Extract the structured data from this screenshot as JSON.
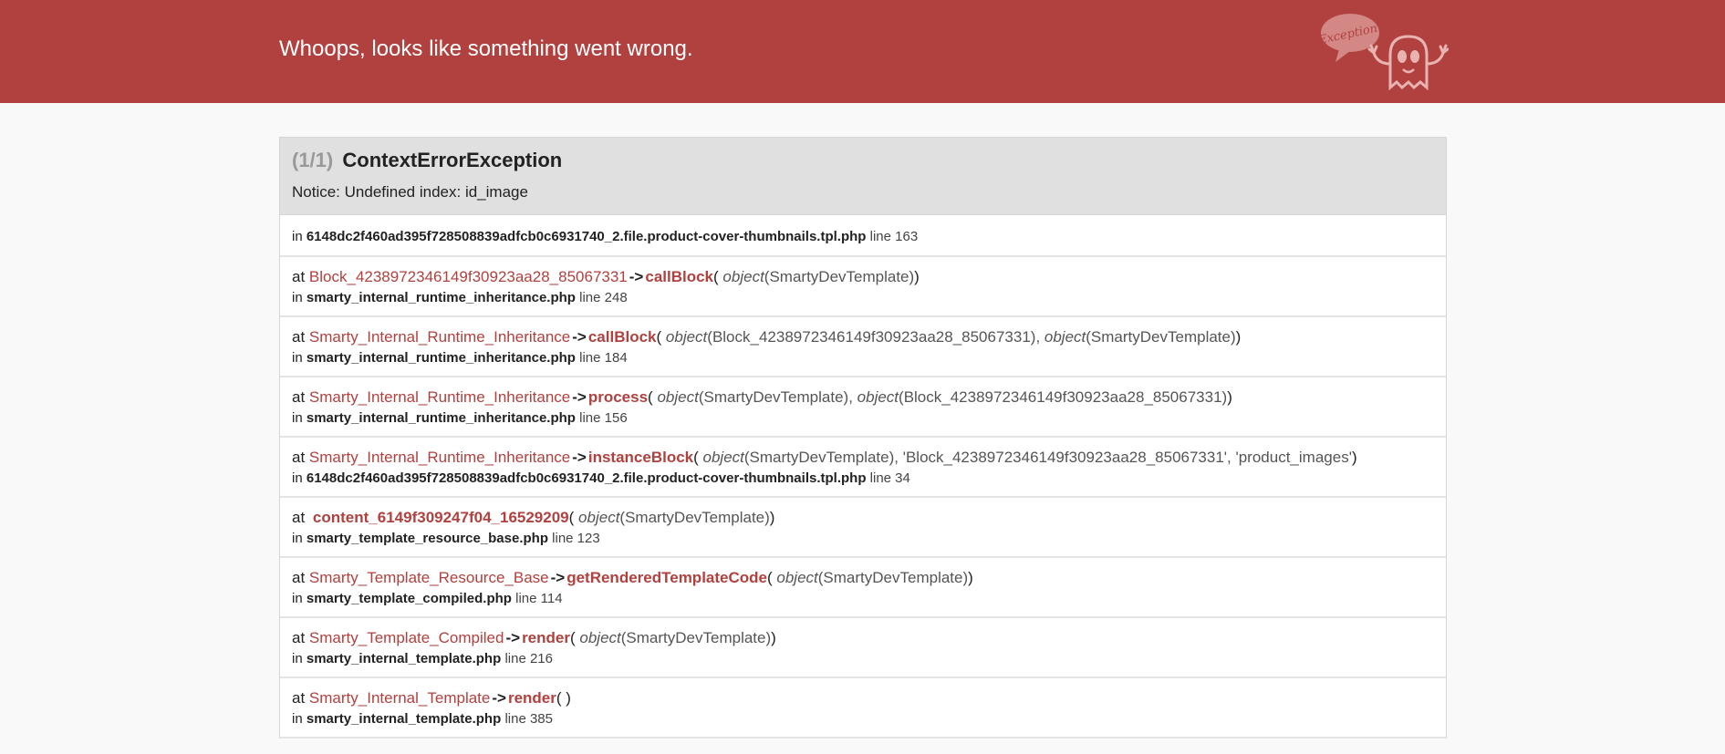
{
  "header": {
    "title": "Whoops, looks like something went wrong.",
    "logo_text": "Exception!"
  },
  "exception": {
    "count": "(1/1)",
    "name": "ContextErrorException",
    "message": "Notice: Undefined index: id_image",
    "file": "6148dc2f460ad395f728508839adfcb0c6931740_2.file.product-cover-thumbnails.tpl.php",
    "line": "line 163"
  },
  "trace": [
    {
      "at": "at",
      "cls": "Block_4238972346149f30923aa28_85067331",
      "arrow": "->",
      "fn": "callBlock",
      "args_open": "(",
      "args": " object(SmartyDevTemplate)",
      "args_close": ")",
      "in": "in",
      "file": "smarty_internal_runtime_inheritance.php",
      "line": "line 248"
    },
    {
      "at": "at",
      "cls": "Smarty_Internal_Runtime_Inheritance",
      "arrow": "->",
      "fn": "callBlock",
      "args_open": "(",
      "args": " object(Block_4238972346149f30923aa28_85067331), object(SmartyDevTemplate)",
      "args_close": ")",
      "in": "in",
      "file": "smarty_internal_runtime_inheritance.php",
      "line": "line 184"
    },
    {
      "at": "at",
      "cls": "Smarty_Internal_Runtime_Inheritance",
      "arrow": "->",
      "fn": "process",
      "args_open": "(",
      "args": " object(SmartyDevTemplate), object(Block_4238972346149f30923aa28_85067331)",
      "args_close": ")",
      "in": "in",
      "file": "smarty_internal_runtime_inheritance.php",
      "line": "line 156"
    },
    {
      "at": "at",
      "cls": "Smarty_Internal_Runtime_Inheritance",
      "arrow": "->",
      "fn": "instanceBlock",
      "args_open": "(",
      "args": " object(SmartyDevTemplate), 'Block_4238972346149f30923aa28_85067331', 'product_images'",
      "args_close": ")",
      "in": "in",
      "file": "6148dc2f460ad395f728508839adfcb0c6931740_2.file.product-cover-thumbnails.tpl.php",
      "line": "line 34"
    },
    {
      "at": "at",
      "cls": "",
      "arrow": "",
      "fn": "content_6149f309247f04_16529209",
      "args_open": "(",
      "args": " object(SmartyDevTemplate)",
      "args_close": ")",
      "in": "in",
      "file": "smarty_template_resource_base.php",
      "line": "line 123"
    },
    {
      "at": "at",
      "cls": "Smarty_Template_Resource_Base",
      "arrow": "->",
      "fn": "getRenderedTemplateCode",
      "args_open": "(",
      "args": " object(SmartyDevTemplate)",
      "args_close": ")",
      "in": "in",
      "file": "smarty_template_compiled.php",
      "line": "line 114"
    },
    {
      "at": "at",
      "cls": "Smarty_Template_Compiled",
      "arrow": "->",
      "fn": "render",
      "args_open": "(",
      "args": " object(SmartyDevTemplate)",
      "args_close": ")",
      "in": "in",
      "file": "smarty_internal_template.php",
      "line": "line 216"
    },
    {
      "at": "at",
      "cls": "Smarty_Internal_Template",
      "arrow": "->",
      "fn": "render",
      "args_open": "(",
      "args": " ",
      "args_close": ")",
      "in": "in",
      "file": "smarty_internal_template.php",
      "line": "line 385"
    }
  ]
}
